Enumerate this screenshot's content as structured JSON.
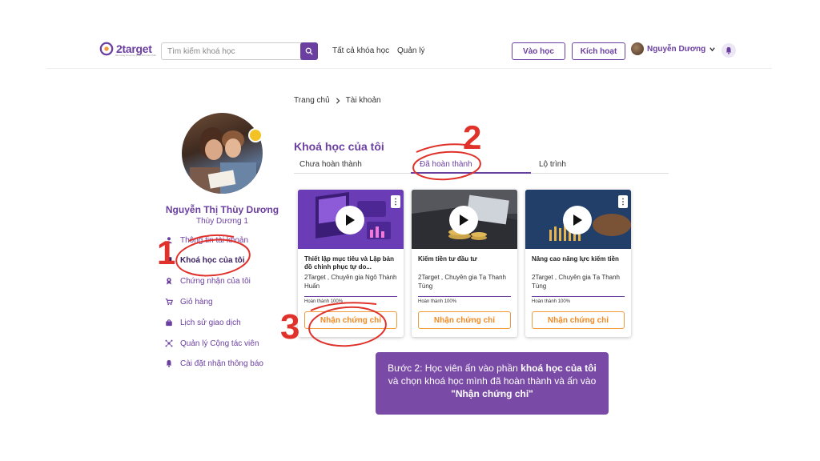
{
  "header": {
    "logo_text": "2target",
    "logo_sub": "Nền tảng khoá học phát triển bản thân",
    "search_placeholder": "Tìm kiếm khoá học",
    "nav": [
      "Tất cả khóa học",
      "Quản lý"
    ],
    "btn_enter": "Vào học",
    "btn_activate": "Kích hoạt",
    "user_name": "Nguyễn Dương"
  },
  "profile": {
    "name": "Nguyễn Thị Thùy Dương",
    "username": "Thùy Dương 1"
  },
  "menu": [
    {
      "label": "Thông tin tài khoản",
      "icon": "user-icon"
    },
    {
      "label": "Khoá học của tôi",
      "icon": "book-icon"
    },
    {
      "label": "Chứng nhận của tôi",
      "icon": "award-icon"
    },
    {
      "label": "Giỏ hàng",
      "icon": "cart-icon"
    },
    {
      "label": "Lịch sử giao dịch",
      "icon": "bag-icon"
    },
    {
      "label": "Quản lý Cộng tác viên",
      "icon": "network-icon"
    },
    {
      "label": "Cài đặt nhận thông báo",
      "icon": "bell-icon"
    }
  ],
  "breadcrumb": {
    "home": "Trang chủ",
    "current": "Tài khoản"
  },
  "section_title": "Khoá học của tôi",
  "tabs": [
    "Chưa hoàn thành",
    "Đã hoàn thành",
    "Lộ trình"
  ],
  "cards": [
    {
      "title": "Thiết lập mục tiêu và Lập bản đồ chinh phục tự do...",
      "author": "2Target , Chuyên gia Ngô Thành Huấn",
      "status": "Hoàn thành 100%",
      "button": "Nhận chứng chỉ"
    },
    {
      "title": "Kiếm tiền tư đầu tư",
      "author": "2Target , Chuyên gia Tạ Thanh Tùng",
      "status": "Hoàn thành 100%",
      "button": "Nhận chứng chỉ"
    },
    {
      "title": "Nâng cao năng lực kiếm tiền",
      "author": "2Target , Chuyên gia Tạ Thanh Tùng",
      "status": "Hoàn thành 100%",
      "button": "Nhận chứng chỉ"
    }
  ],
  "callout": {
    "part1": "Bước 2: Học viên ấn vào phần ",
    "bold1": "khoá học của tôi",
    "part2": " và chọn khoá học mình đã hoàn thành và ấn vào ",
    "bold2": "\"Nhận chứng chỉ\""
  },
  "annotations": {
    "n1": "1",
    "n2": "2",
    "n3": "3"
  },
  "colors": {
    "accent": "#6b3fa0",
    "orange": "#f08a24",
    "annotation_red": "#e0322b"
  }
}
